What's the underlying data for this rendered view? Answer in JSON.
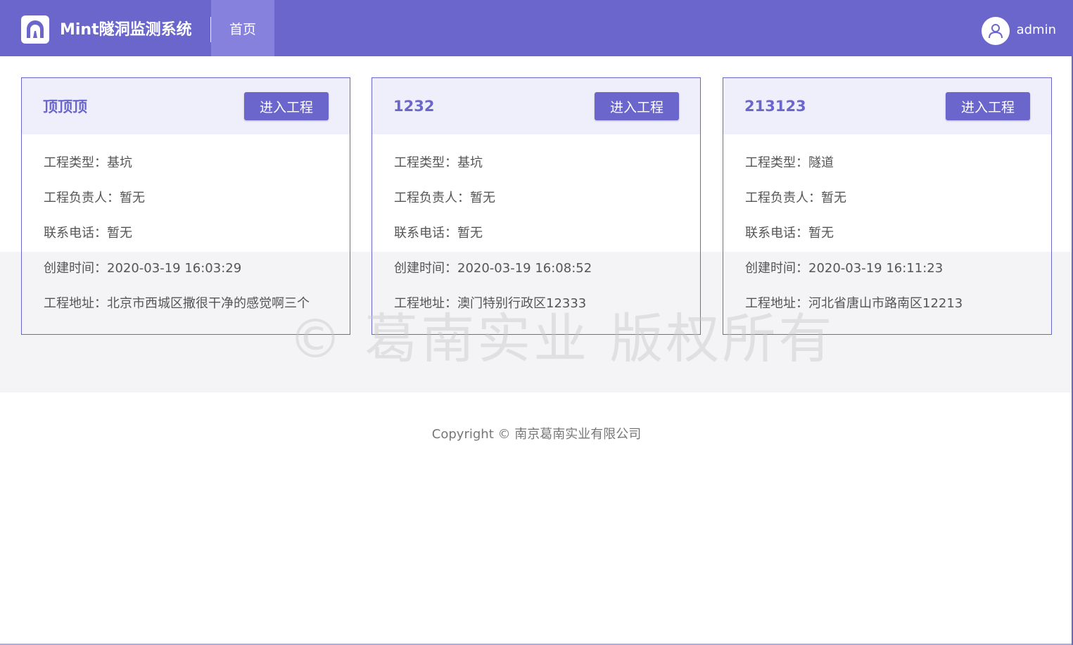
{
  "header": {
    "app_title": "Mint隧洞监测系统",
    "nav": {
      "home_label": "首页"
    },
    "user": {
      "name": "admin"
    }
  },
  "projects": [
    {
      "name": "顶顶顶",
      "enter_label": "进入工程",
      "type_label": "工程类型：",
      "type": "基坑",
      "owner_label": "工程负责人：",
      "owner": "暂无",
      "phone_label": "联系电话：",
      "phone": "暂无",
      "created_label": "创建时间：",
      "created": "2020-03-19 16:03:29",
      "address_label": "工程地址：",
      "address": "北京市西城区撒很干净的感觉啊三个"
    },
    {
      "name": "1232",
      "enter_label": "进入工程",
      "type_label": "工程类型：",
      "type": "基坑",
      "owner_label": "工程负责人：",
      "owner": "暂无",
      "phone_label": "联系电话：",
      "phone": "暂无",
      "created_label": "创建时间：",
      "created": "2020-03-19 16:08:52",
      "address_label": "工程地址：",
      "address": "澳门特别行政区12333"
    },
    {
      "name": "213123",
      "enter_label": "进入工程",
      "type_label": "工程类型：",
      "type": "隧道",
      "owner_label": "工程负责人：",
      "owner": "暂无",
      "phone_label": "联系电话：",
      "phone": "暂无",
      "created_label": "创建时间：",
      "created": "2020-03-19 16:11:23",
      "address_label": "工程地址：",
      "address": "河北省唐山市路南区12213"
    }
  ],
  "watermark": "© 葛南实业 版权所有",
  "footer": {
    "copyright": "Copyright © 南京葛南实业有限公司"
  },
  "colors": {
    "primary": "#6a66cc",
    "nav_active": "#8681dc",
    "card_head": "#efeffb",
    "band": "#f4f4f6"
  },
  "icons": {
    "logo": "tunnel-icon",
    "avatar": "user-icon"
  }
}
